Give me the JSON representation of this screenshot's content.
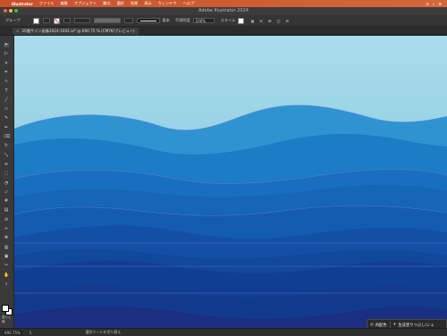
{
  "menubar": {
    "app": "Illustrator",
    "items": [
      "ファイル",
      "編集",
      "オブジェクト",
      "書式",
      "選択",
      "効果",
      "表示",
      "ウィンドウ",
      "ヘルプ"
    ],
    "color": "#c9512c"
  },
  "window": {
    "title": "Adobe Illustrator 2024"
  },
  "control": {
    "group_label": "グループ",
    "opacity_label": "不透明度",
    "opacity_value": "100%",
    "style_label": "スタイル",
    "stroke_style": "基本"
  },
  "document": {
    "tab_close": "×",
    "tab_label": "20番サイン画像2024-1002.ai* @ 690.75 % (CMYK/プレビュー)"
  },
  "canvas": {
    "sky_top": "#a9dcea",
    "sky_bottom": "#75c1dc",
    "wave_light": "#2a8fd0",
    "wave_mid": "#1566b7",
    "wave_dark": "#103a8f",
    "wave_deep": "#1a2f82"
  },
  "toolbar": {
    "color_label": "塗りと線",
    "tools": [
      "selection-tool",
      "direct-selection-tool",
      "magic-wand-tool",
      "pen-tool",
      "curvature-tool",
      "type-tool",
      "line-tool",
      "rectangle-tool",
      "paintbrush-tool",
      "pencil-tool",
      "eraser-tool",
      "rotate-tool",
      "scale-tool",
      "width-tool",
      "free-transform-tool",
      "shape-builder-tool",
      "perspective-tool",
      "mesh-tool",
      "gradient-tool",
      "eyedropper-tool",
      "blend-tool",
      "symbol-tool",
      "graph-tool",
      "artboard-tool",
      "slice-tool",
      "hand-tool",
      "zoom-tool"
    ]
  },
  "status": {
    "zoom": "690.75%",
    "page": "1",
    "tip": "選択ツールを切り替え"
  },
  "context_bar": {
    "recolor_label": "再配色",
    "generate_label": "生成塗りつぶし(シェ"
  }
}
